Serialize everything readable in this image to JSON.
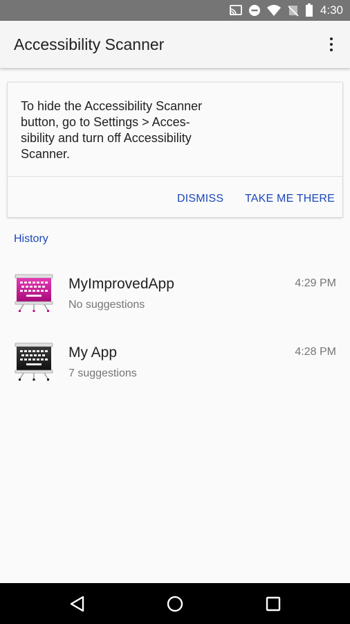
{
  "status_bar": {
    "time": "4:30",
    "icons": [
      "cast-icon",
      "do-not-disturb-icon",
      "wifi-icon",
      "no-sim-icon",
      "battery-icon"
    ]
  },
  "app_bar": {
    "title": "Accessibility Scanner",
    "overflow_icon": "more-vert-icon"
  },
  "card": {
    "message": "To hide the Accessibility Scanner\nbutton, go to Settings > Acces-\nsibility and turn off Accessibility\nScanner.",
    "dismiss_label": "DISMISS",
    "take_me_there_label": "TAKE ME THERE"
  },
  "history": {
    "header": "History",
    "items": [
      {
        "name": "MyImprovedApp",
        "subtitle": "No suggestions",
        "time": "4:29 PM",
        "icon": "keyboard-easel-icon",
        "icon_color": "#c2128c"
      },
      {
        "name": "My App",
        "subtitle": "7 suggestions",
        "time": "4:28 PM",
        "icon": "keyboard-easel-icon",
        "icon_color": "#1a1a1a"
      }
    ]
  },
  "nav_bar": {
    "icons": [
      "back-triangle-icon",
      "home-circle-icon",
      "recents-square-icon"
    ]
  },
  "colors": {
    "accent": "#1a47b8",
    "status_bar": "#757575",
    "app_bar": "#f5f5f5",
    "background": "#fafafa",
    "nav_bar": "#000000"
  }
}
